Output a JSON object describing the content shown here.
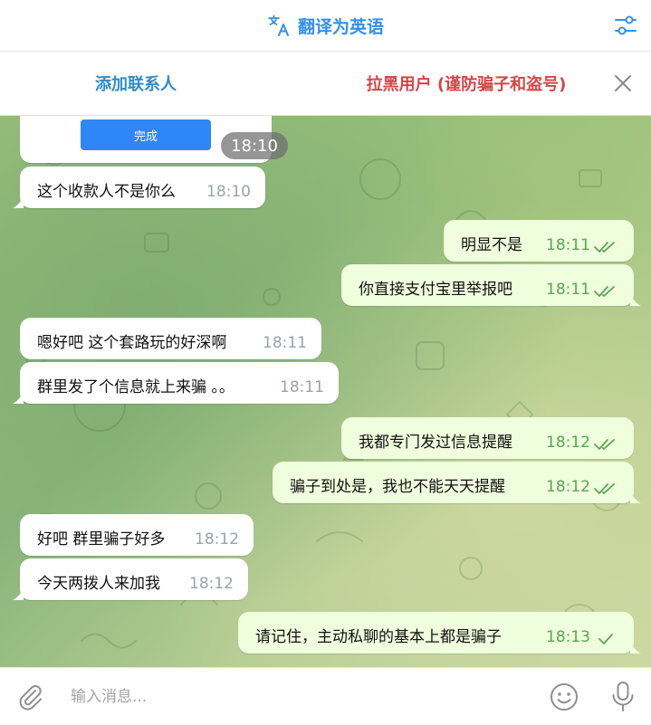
{
  "topbar": {
    "translate_label": "翻译为英语",
    "translate_icon": "translate-icon",
    "filter_icon": "sliders-icon"
  },
  "actionbar": {
    "add_contact": "添加联系人",
    "block_user": "拉黑用户 (谨防骗子和盗号)",
    "close_icon": "close-icon"
  },
  "colors": {
    "accent": "#3390ec",
    "danger": "#d64545",
    "outgoing_bubble": "#effedd",
    "incoming_bubble": "#ffffff",
    "outgoing_time": "#59a652",
    "done_button": "#2f86f6"
  },
  "card": {
    "done_label": "完成",
    "time": "18:10"
  },
  "messages": [
    {
      "dir": "in",
      "text": "这个收款人不是你么",
      "time": "18:10"
    },
    {
      "dir": "out",
      "text": "明显不是",
      "time": "18:11",
      "status": "read"
    },
    {
      "dir": "out",
      "text": "你直接支付宝里举报吧",
      "time": "18:11",
      "status": "read"
    },
    {
      "dir": "in",
      "text": "嗯好吧 这个套路玩的好深啊",
      "time": "18:11"
    },
    {
      "dir": "in",
      "text": "群里发了个信息就上来骗 。。",
      "time": "18:11"
    },
    {
      "dir": "out",
      "text": "我都专门发过信息提醒",
      "time": "18:12",
      "status": "read"
    },
    {
      "dir": "out",
      "text": "骗子到处是，我也不能天天提醒",
      "time": "18:12",
      "status": "read"
    },
    {
      "dir": "in",
      "text": "好吧 群里骗子好多",
      "time": "18:12"
    },
    {
      "dir": "in",
      "text": "今天两拨人来加我",
      "time": "18:12"
    },
    {
      "dir": "out",
      "text": "请记住，主动私聊的基本上都是骗子",
      "time": "18:13",
      "status": "sent"
    }
  ],
  "composer": {
    "placeholder": "输入消息...",
    "value": "",
    "attach_icon": "paperclip-icon",
    "emoji_icon": "emoji-icon",
    "mic_icon": "microphone-icon"
  }
}
